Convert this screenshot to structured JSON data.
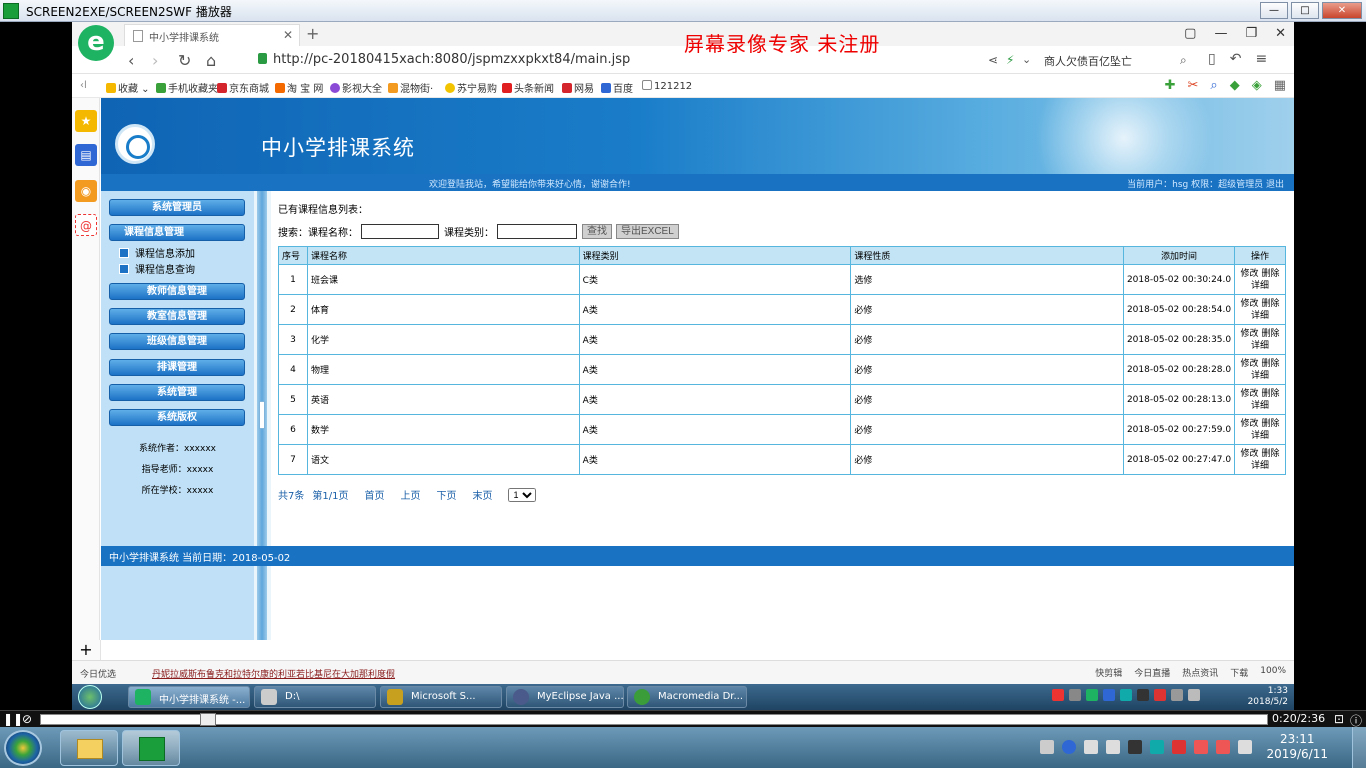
{
  "player": {
    "title": "SCREEN2EXE/SCREEN2SWF 播放器",
    "time": "0:20/2:36"
  },
  "browser": {
    "tab_title": "中小学排课系统",
    "watermark": "屏幕录像专家  未注册",
    "url": "http://pc-20180415xach:8080/jspmzxxpkxt84/main.jsp",
    "search_text": "商人欠债百亿坠亡",
    "bookmarks": [
      "收藏",
      "手机收藏夹",
      "京东商城",
      "淘 宝 网",
      "影视大全",
      "混物街·",
      "苏宁易购",
      "头条新闻",
      "网易",
      "百度",
      "121212"
    ],
    "status_left": "今日优选",
    "status_news": "丹妮拉威斯布鲁克和拉特尔康的利亚若比基尼在大加那利度假",
    "status_right": [
      "快剪辑",
      "今日直播",
      "热点资讯",
      "下载",
      "100%"
    ]
  },
  "app": {
    "system_title": "中小学排课系统",
    "welcome": "欢迎登陆我站，希望能给你带来好心情，谢谢合作!",
    "user_info": "当前用户：hsg 权限：超级管理员 退出",
    "nav": {
      "sys_admin": "系统管理员",
      "course_mgmt": "课程信息管理",
      "course_add": "课程信息添加",
      "course_query": "课程信息查询",
      "teacher_mgmt": "教师信息管理",
      "room_mgmt": "教室信息管理",
      "class_mgmt": "班级信息管理",
      "schedule_mgmt": "排课管理",
      "system_mgmt": "系统管理",
      "copyright": "系统版权"
    },
    "credits": {
      "author": "系统作者：xxxxxx",
      "teacher": "指导老师：xxxxx",
      "school": "所在学校：xxxxx"
    },
    "list_label": "已有课程信息列表：",
    "search": {
      "label": "搜索：",
      "name_label": "课程名称：",
      "type_label": "课程类别：",
      "search_btn": "查找",
      "export_btn": "导出EXCEL"
    },
    "table": {
      "headers": [
        "序号",
        "课程名称",
        "课程类别",
        "课程性质",
        "添加时间",
        "操作"
      ],
      "ops": {
        "edit": "修改",
        "delete": "删除",
        "detail": "详细"
      },
      "rows": [
        {
          "no": "1",
          "name": "班会课",
          "type": "C类",
          "nature": "选修",
          "time": "2018-05-02 00:30:24.0"
        },
        {
          "no": "2",
          "name": "体育",
          "type": "A类",
          "nature": "必修",
          "time": "2018-05-02 00:28:54.0"
        },
        {
          "no": "3",
          "name": "化学",
          "type": "A类",
          "nature": "必修",
          "time": "2018-05-02 00:28:35.0"
        },
        {
          "no": "4",
          "name": "物理",
          "type": "A类",
          "nature": "必修",
          "time": "2018-05-02 00:28:28.0"
        },
        {
          "no": "5",
          "name": "英语",
          "type": "A类",
          "nature": "必修",
          "time": "2018-05-02 00:28:13.0"
        },
        {
          "no": "6",
          "name": "数学",
          "type": "A类",
          "nature": "必修",
          "time": "2018-05-02 00:27:59.0"
        },
        {
          "no": "7",
          "name": "语文",
          "type": "A类",
          "nature": "必修",
          "time": "2018-05-02 00:27:47.0"
        }
      ]
    },
    "pager": {
      "total": "共7条",
      "page": "第1/1页",
      "first": "首页",
      "prev": "上页",
      "next": "下页",
      "last": "末页",
      "selected": "1"
    },
    "footer": "中小学排课系统 当前日期：2018-05-02"
  },
  "taskbar1": {
    "items": [
      "中小学排课系统 -...",
      "D:\\",
      "Microsoft S...",
      "MyEclipse Java ...",
      "Macromedia Dr..."
    ],
    "time": "1:33",
    "date": "2018/5/2"
  },
  "taskbar2": {
    "time": "23:11",
    "date": "2019/6/11"
  }
}
